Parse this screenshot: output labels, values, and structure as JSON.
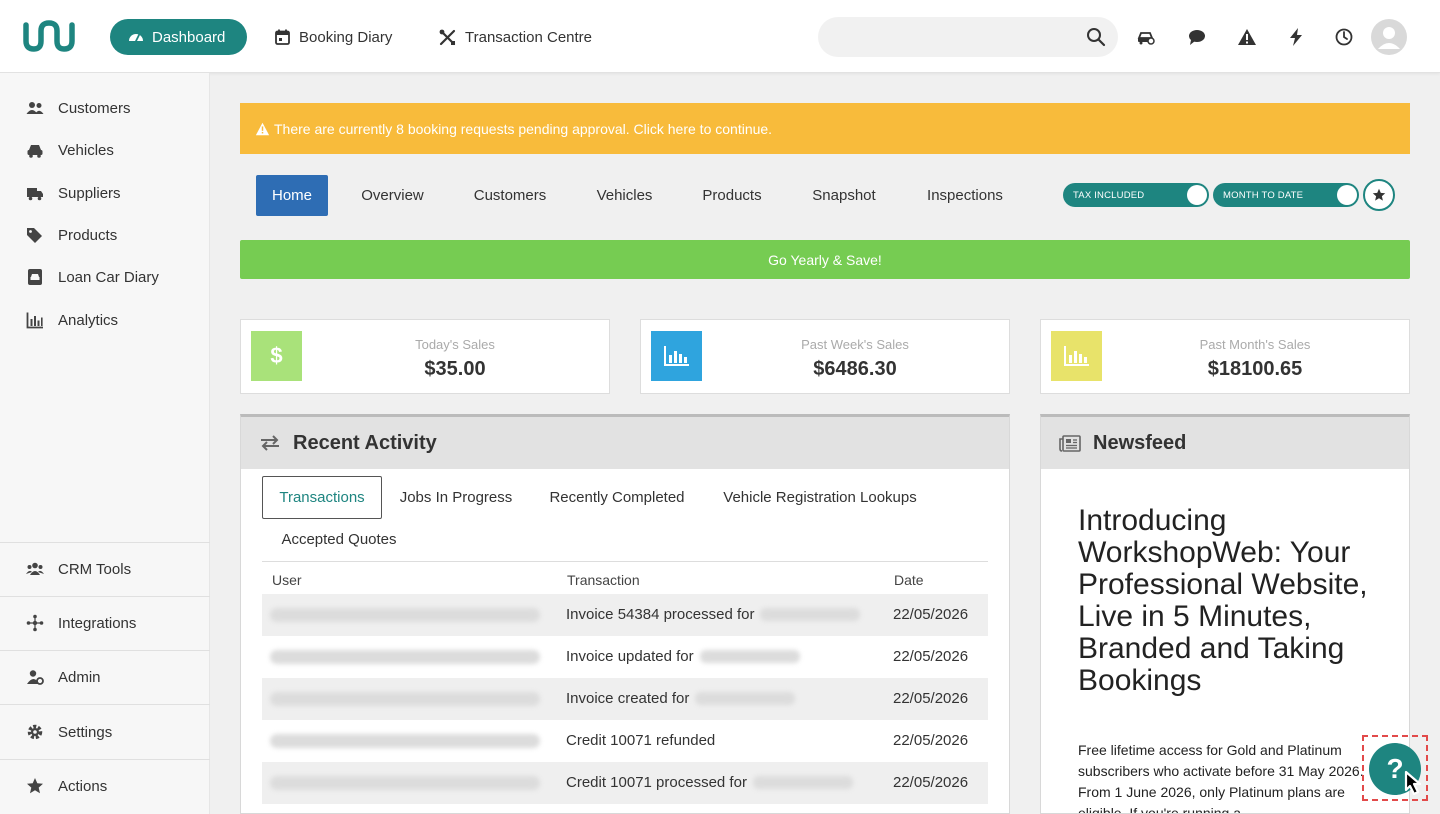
{
  "nav": {
    "dashboard": "Dashboard",
    "booking_diary": "Booking Diary",
    "transaction_centre": "Transaction Centre",
    "search_placeholder": ""
  },
  "sidebar": {
    "items": [
      "Customers",
      "Vehicles",
      "Suppliers",
      "Products",
      "Loan Car Diary",
      "Analytics"
    ],
    "bottom": [
      "CRM Tools",
      "Integrations",
      "Admin",
      "Settings",
      "Actions"
    ]
  },
  "alert": "There are currently 8 booking requests pending approval. Click here to continue.",
  "tabs": [
    "Home",
    "Overview",
    "Customers",
    "Vehicles",
    "Products",
    "Snapshot",
    "Inspections"
  ],
  "toggles": {
    "tax": "TAX INCLUDED",
    "period": "MONTH TO DATE"
  },
  "promo": "Go Yearly & Save!",
  "stats": [
    {
      "label": "Today's Sales",
      "value": "$35.00"
    },
    {
      "label": "Past Week's Sales",
      "value": "$6486.30"
    },
    {
      "label": "Past Month's Sales",
      "value": "$18100.65"
    }
  ],
  "recent_activity": {
    "title": "Recent Activity",
    "tabs": [
      "Transactions",
      "Jobs In Progress",
      "Recently Completed",
      "Vehicle Registration Lookups",
      "Accepted Quotes"
    ],
    "columns": [
      "User",
      "Transaction",
      "Date"
    ],
    "rows": [
      {
        "transaction": "Invoice 54384 processed for",
        "date": "22/05/2026"
      },
      {
        "transaction": "Invoice updated for",
        "date": "22/05/2026"
      },
      {
        "transaction": "Invoice created for",
        "date": "22/05/2026"
      },
      {
        "transaction": "Credit 10071 refunded",
        "date": "22/05/2026"
      },
      {
        "transaction": "Credit 10071 processed for",
        "date": "22/05/2026"
      }
    ]
  },
  "newsfeed": {
    "title": "Newsfeed",
    "headline": "Introducing WorkshopWeb: Your Professional Website, Live in 5 Minutes, Branded and Taking Bookings",
    "body": "Free lifetime access for Gold and Platinum subscribers who activate before 31 May 2026. From 1 June 2026, only Platinum plans are eligible. If you're running a"
  },
  "help": {
    "label": "?"
  },
  "colors": {
    "brand": "#1e8580",
    "alert": "#f8bb3b",
    "promo": "#76cc52",
    "home_tab": "#2e6db4"
  }
}
